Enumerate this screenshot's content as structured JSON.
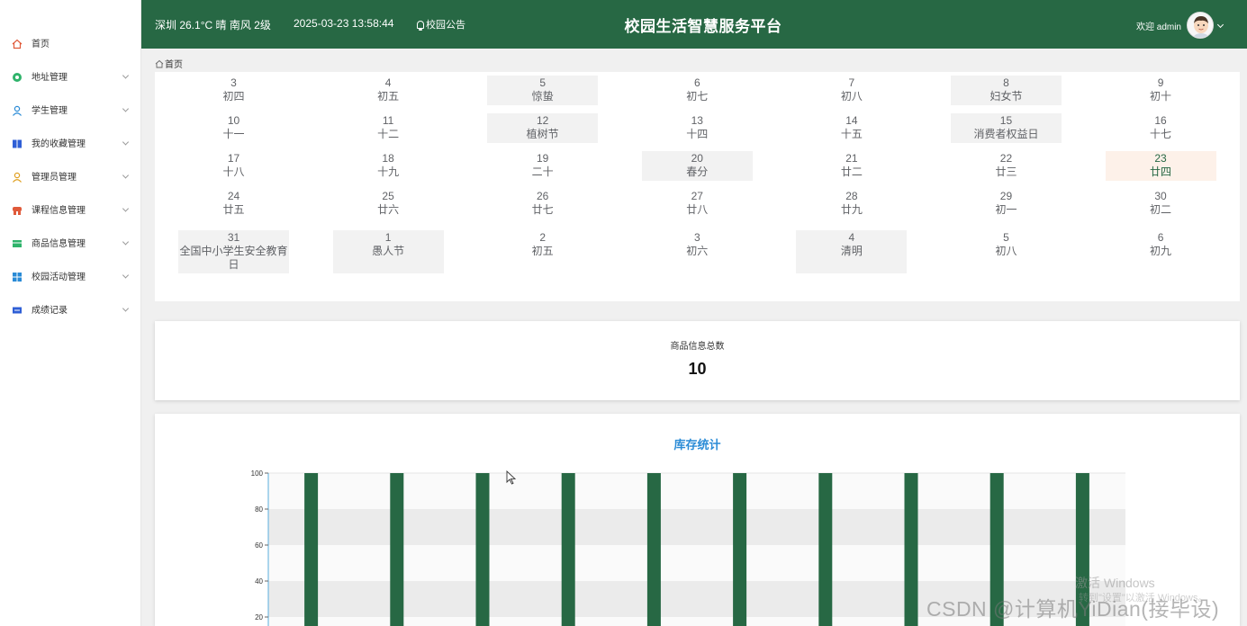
{
  "colors": {
    "header_bg": "#276844",
    "bar": "#276844",
    "chart_title": "#2a8bd6",
    "today_bg": "#fdf1e9"
  },
  "sidebar": {
    "items": [
      {
        "label": "首页",
        "icon": "home-icon",
        "color": "#e05a3a",
        "expandable": false
      },
      {
        "label": "地址管理",
        "icon": "location-icon",
        "color": "#2fb36b",
        "expandable": true
      },
      {
        "label": "学生管理",
        "icon": "user-icon",
        "color": "#2a8bd6",
        "expandable": true
      },
      {
        "label": "我的收藏管理",
        "icon": "book-icon",
        "color": "#2f5fd6",
        "expandable": true
      },
      {
        "label": "管理员管理",
        "icon": "admin-icon",
        "color": "#e0a020",
        "expandable": true
      },
      {
        "label": "课程信息管理",
        "icon": "course-icon",
        "color": "#e05a3a",
        "expandable": true
      },
      {
        "label": "商品信息管理",
        "icon": "goods-icon",
        "color": "#2fb36b",
        "expandable": true
      },
      {
        "label": "校园活动管理",
        "icon": "grid-icon",
        "color": "#2a8bd6",
        "expandable": true
      },
      {
        "label": "成绩记录",
        "icon": "score-icon",
        "color": "#2f5fd6",
        "expandable": true
      }
    ]
  },
  "header": {
    "weather": "深圳 26.1°C 晴 南风 2级",
    "datetime": "2025-03-23 13:58:44",
    "notice": "校园公告",
    "title": "校园生活智慧服务平台",
    "welcome": "欢迎 admin"
  },
  "breadcrumb": {
    "home": "首页"
  },
  "calendar": {
    "rows": [
      [
        {
          "day": "3",
          "sub": "初四"
        },
        {
          "day": "4",
          "sub": "初五"
        },
        {
          "day": "5",
          "sub": "惊蛰",
          "hl": true
        },
        {
          "day": "6",
          "sub": "初七"
        },
        {
          "day": "7",
          "sub": "初八"
        },
        {
          "day": "8",
          "sub": "妇女节",
          "hl": true
        },
        {
          "day": "9",
          "sub": "初十"
        }
      ],
      [
        {
          "day": "10",
          "sub": "十一"
        },
        {
          "day": "11",
          "sub": "十二"
        },
        {
          "day": "12",
          "sub": "植树节",
          "hl": true
        },
        {
          "day": "13",
          "sub": "十四"
        },
        {
          "day": "14",
          "sub": "十五"
        },
        {
          "day": "15",
          "sub": "消费者权益日",
          "hl": true
        },
        {
          "day": "16",
          "sub": "十七"
        }
      ],
      [
        {
          "day": "17",
          "sub": "十八"
        },
        {
          "day": "18",
          "sub": "十九"
        },
        {
          "day": "19",
          "sub": "二十"
        },
        {
          "day": "20",
          "sub": "春分",
          "hl": true
        },
        {
          "day": "21",
          "sub": "廿二"
        },
        {
          "day": "22",
          "sub": "廿三"
        },
        {
          "day": "23",
          "sub": "廿四",
          "today": true
        }
      ],
      [
        {
          "day": "24",
          "sub": "廿五"
        },
        {
          "day": "25",
          "sub": "廿六"
        },
        {
          "day": "26",
          "sub": "廿七"
        },
        {
          "day": "27",
          "sub": "廿八"
        },
        {
          "day": "28",
          "sub": "廿九"
        },
        {
          "day": "29",
          "sub": "初一"
        },
        {
          "day": "30",
          "sub": "初二"
        }
      ],
      [
        {
          "day": "31",
          "sub": "全国中小学生安全教育日",
          "hl": true
        },
        {
          "day": "1",
          "sub": "愚人节",
          "hl": true
        },
        {
          "day": "2",
          "sub": "初五"
        },
        {
          "day": "3",
          "sub": "初六"
        },
        {
          "day": "4",
          "sub": "清明",
          "hl": true
        },
        {
          "day": "5",
          "sub": "初八"
        },
        {
          "day": "6",
          "sub": "初九"
        }
      ]
    ]
  },
  "stat": {
    "label": "商品信息总数",
    "value": "10"
  },
  "chart_data": {
    "type": "bar",
    "title": "库存统计",
    "categories": [
      "",
      "",
      "",
      "",
      "",
      "",
      "",
      "",
      "",
      ""
    ],
    "values": [
      100,
      100,
      100,
      100,
      100,
      100,
      100,
      100,
      100,
      100
    ],
    "ylim": [
      0,
      100
    ],
    "yticks": [
      100,
      80,
      60,
      40,
      20
    ],
    "xlabel": "",
    "ylabel": "",
    "grid": "alternating bands"
  },
  "watermarks": {
    "windows": "激活 Windows",
    "windows_sub": "转到\"设置\"以激活 Windows。",
    "csdn": "CSDN @计算机YiDian(接毕设)"
  }
}
